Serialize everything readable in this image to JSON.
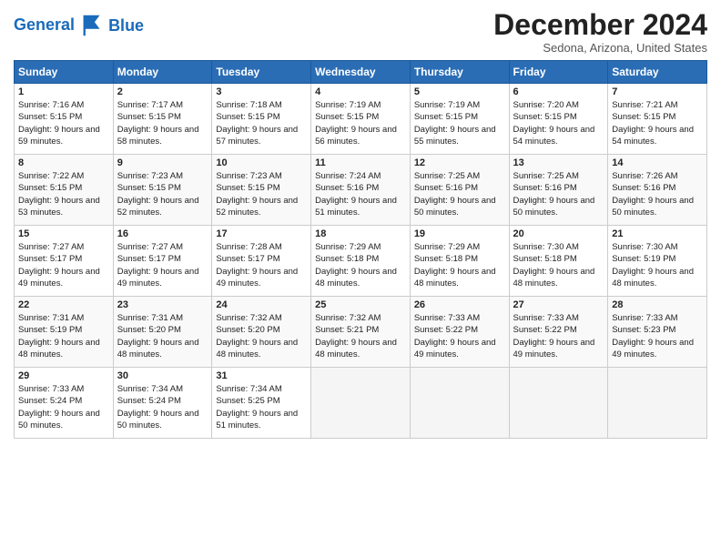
{
  "header": {
    "logo_line1": "General",
    "logo_line2": "Blue",
    "month": "December 2024",
    "location": "Sedona, Arizona, United States"
  },
  "weekdays": [
    "Sunday",
    "Monday",
    "Tuesday",
    "Wednesday",
    "Thursday",
    "Friday",
    "Saturday"
  ],
  "weeks": [
    [
      {
        "day": "1",
        "rise": "7:16 AM",
        "set": "5:15 PM",
        "daylight": "9 hours and 59 minutes."
      },
      {
        "day": "2",
        "rise": "7:17 AM",
        "set": "5:15 PM",
        "daylight": "9 hours and 58 minutes."
      },
      {
        "day": "3",
        "rise": "7:18 AM",
        "set": "5:15 PM",
        "daylight": "9 hours and 57 minutes."
      },
      {
        "day": "4",
        "rise": "7:19 AM",
        "set": "5:15 PM",
        "daylight": "9 hours and 56 minutes."
      },
      {
        "day": "5",
        "rise": "7:19 AM",
        "set": "5:15 PM",
        "daylight": "9 hours and 55 minutes."
      },
      {
        "day": "6",
        "rise": "7:20 AM",
        "set": "5:15 PM",
        "daylight": "9 hours and 54 minutes."
      },
      {
        "day": "7",
        "rise": "7:21 AM",
        "set": "5:15 PM",
        "daylight": "9 hours and 54 minutes."
      }
    ],
    [
      {
        "day": "8",
        "rise": "7:22 AM",
        "set": "5:15 PM",
        "daylight": "9 hours and 53 minutes."
      },
      {
        "day": "9",
        "rise": "7:23 AM",
        "set": "5:15 PM",
        "daylight": "9 hours and 52 minutes."
      },
      {
        "day": "10",
        "rise": "7:23 AM",
        "set": "5:15 PM",
        "daylight": "9 hours and 52 minutes."
      },
      {
        "day": "11",
        "rise": "7:24 AM",
        "set": "5:16 PM",
        "daylight": "9 hours and 51 minutes."
      },
      {
        "day": "12",
        "rise": "7:25 AM",
        "set": "5:16 PM",
        "daylight": "9 hours and 50 minutes."
      },
      {
        "day": "13",
        "rise": "7:25 AM",
        "set": "5:16 PM",
        "daylight": "9 hours and 50 minutes."
      },
      {
        "day": "14",
        "rise": "7:26 AM",
        "set": "5:16 PM",
        "daylight": "9 hours and 50 minutes."
      }
    ],
    [
      {
        "day": "15",
        "rise": "7:27 AM",
        "set": "5:17 PM",
        "daylight": "9 hours and 49 minutes."
      },
      {
        "day": "16",
        "rise": "7:27 AM",
        "set": "5:17 PM",
        "daylight": "9 hours and 49 minutes."
      },
      {
        "day": "17",
        "rise": "7:28 AM",
        "set": "5:17 PM",
        "daylight": "9 hours and 49 minutes."
      },
      {
        "day": "18",
        "rise": "7:29 AM",
        "set": "5:18 PM",
        "daylight": "9 hours and 48 minutes."
      },
      {
        "day": "19",
        "rise": "7:29 AM",
        "set": "5:18 PM",
        "daylight": "9 hours and 48 minutes."
      },
      {
        "day": "20",
        "rise": "7:30 AM",
        "set": "5:18 PM",
        "daylight": "9 hours and 48 minutes."
      },
      {
        "day": "21",
        "rise": "7:30 AM",
        "set": "5:19 PM",
        "daylight": "9 hours and 48 minutes."
      }
    ],
    [
      {
        "day": "22",
        "rise": "7:31 AM",
        "set": "5:19 PM",
        "daylight": "9 hours and 48 minutes."
      },
      {
        "day": "23",
        "rise": "7:31 AM",
        "set": "5:20 PM",
        "daylight": "9 hours and 48 minutes."
      },
      {
        "day": "24",
        "rise": "7:32 AM",
        "set": "5:20 PM",
        "daylight": "9 hours and 48 minutes."
      },
      {
        "day": "25",
        "rise": "7:32 AM",
        "set": "5:21 PM",
        "daylight": "9 hours and 48 minutes."
      },
      {
        "day": "26",
        "rise": "7:33 AM",
        "set": "5:22 PM",
        "daylight": "9 hours and 49 minutes."
      },
      {
        "day": "27",
        "rise": "7:33 AM",
        "set": "5:22 PM",
        "daylight": "9 hours and 49 minutes."
      },
      {
        "day": "28",
        "rise": "7:33 AM",
        "set": "5:23 PM",
        "daylight": "9 hours and 49 minutes."
      }
    ],
    [
      {
        "day": "29",
        "rise": "7:33 AM",
        "set": "5:24 PM",
        "daylight": "9 hours and 50 minutes."
      },
      {
        "day": "30",
        "rise": "7:34 AM",
        "set": "5:24 PM",
        "daylight": "9 hours and 50 minutes."
      },
      {
        "day": "31",
        "rise": "7:34 AM",
        "set": "5:25 PM",
        "daylight": "9 hours and 51 minutes."
      },
      null,
      null,
      null,
      null
    ]
  ]
}
